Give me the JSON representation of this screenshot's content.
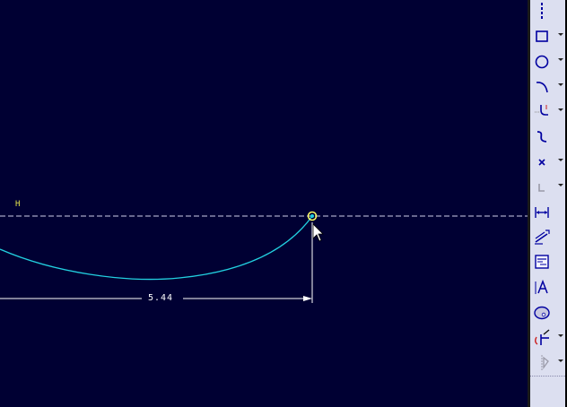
{
  "canvas": {
    "horizontal_reference_label": "H",
    "dimension_value": "5.44",
    "colors": {
      "background": "#000033",
      "centerline": "#cfcfe8",
      "sketch_curve": "#22d0e0",
      "dimension": "#ffffff",
      "label": "#e6e64c",
      "point": "#ffff66"
    }
  },
  "toolbar": {
    "tools": [
      {
        "icon": "centerline-icon",
        "has_flyout": false
      },
      {
        "icon": "rectangle-icon",
        "has_flyout": true
      },
      {
        "icon": "circle-icon",
        "has_flyout": true
      },
      {
        "icon": "arc-icon",
        "has_flyout": true
      },
      {
        "icon": "fillet-icon",
        "has_flyout": true
      },
      {
        "icon": "spline-icon",
        "has_flyout": false
      },
      {
        "icon": "point-icon",
        "has_flyout": true
      },
      {
        "icon": "coordinate-system-icon",
        "has_flyout": true
      },
      {
        "icon": "dimension-icon",
        "has_flyout": false
      },
      {
        "icon": "modify-icon",
        "has_flyout": false
      },
      {
        "icon": "constraints-icon",
        "has_flyout": false
      },
      {
        "icon": "text-icon",
        "has_flyout": false
      },
      {
        "icon": "palette-icon",
        "has_flyout": false
      },
      {
        "icon": "trim-icon",
        "has_flyout": true
      },
      {
        "icon": "mirror-icon",
        "has_flyout": true
      }
    ]
  }
}
